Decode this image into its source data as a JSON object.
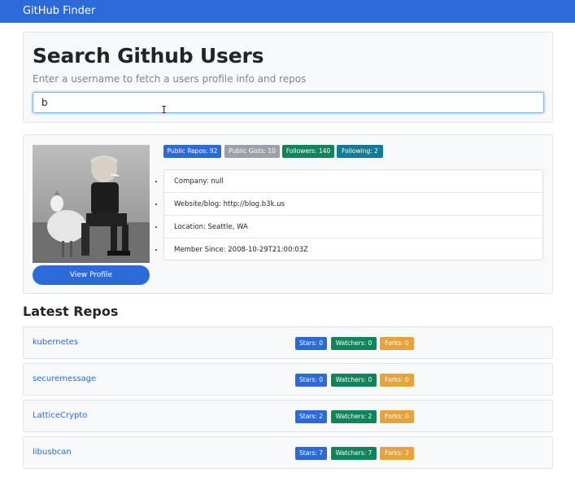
{
  "navbar": {
    "brand": "GitHub Finder"
  },
  "search": {
    "title": "Search Github Users",
    "subtitle": "Enter a username to fetch a users profile info and repos",
    "value": "b"
  },
  "profile": {
    "view_profile_label": "View Profile",
    "badges": {
      "public_repos": "Public Repos: 92",
      "public_gists": "Public Gists: 10",
      "followers": "Followers: 140",
      "following": "Following: 2"
    },
    "info": {
      "company": "Company: null",
      "website": "Website/blog: http://blog.b3k.us",
      "location": "Location: Seattle, WA",
      "member_since": "Member Since: 2008-10-29T21:00:03Z"
    }
  },
  "repos": {
    "heading": "Latest Repos",
    "items": [
      {
        "name": "kubernetes",
        "stars": "Stars: 0",
        "watchers": "Watchers: 0",
        "forks": "Forks: 0"
      },
      {
        "name": "securemessage",
        "stars": "Stars: 0",
        "watchers": "Watchers: 0",
        "forks": "Forks: 0"
      },
      {
        "name": "LatticeCrypto",
        "stars": "Stars: 2",
        "watchers": "Watchers: 2",
        "forks": "Forks: 0"
      },
      {
        "name": "libusbcan",
        "stars": "Stars: 7",
        "watchers": "Watchers: 7",
        "forks": "Forks: 2"
      }
    ]
  },
  "colors": {
    "primary": "#2b6ad8",
    "secondary": "#9aa1a8",
    "success": "#11845a",
    "info": "#127c96",
    "warning": "#e8a23c"
  }
}
